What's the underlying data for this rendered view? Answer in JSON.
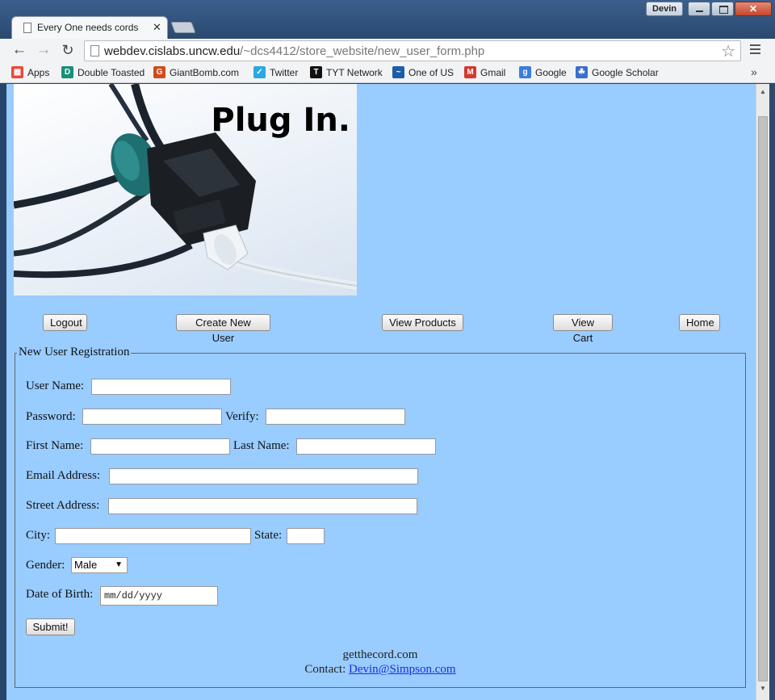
{
  "window": {
    "user_name": "Devin"
  },
  "tab": {
    "title": "Every One needs cords",
    "close_glyph": "✕"
  },
  "toolbar": {
    "url_host": "webdev.cislabs.uncw.edu",
    "url_path": "/~dcs4412/store_website/new_user_form.php"
  },
  "bookmarks": [
    {
      "label": "Apps",
      "icon": "apps-grid-icon",
      "color": "#e64a3b"
    },
    {
      "label": "Double Toasted",
      "icon": "double-toasted-icon",
      "color": "#1a8f7a"
    },
    {
      "label": "GiantBomb.com",
      "icon": "giantbomb-icon",
      "color": "#d24b1c"
    },
    {
      "label": "Twitter",
      "icon": "twitter-bird-icon",
      "color": "#2aa9e0"
    },
    {
      "label": "TYT Network",
      "icon": "tyt-icon",
      "color": "#111111"
    },
    {
      "label": "One of US",
      "icon": "oneofus-icon",
      "color": "#1c5fa8"
    },
    {
      "label": "Gmail",
      "icon": "gmail-icon",
      "color": "#d33a2c"
    },
    {
      "label": "Google",
      "icon": "google-icon",
      "color": "#3b7ddd"
    },
    {
      "label": "Google Scholar",
      "icon": "google-scholar-icon",
      "color": "#3b6fc8"
    }
  ],
  "page": {
    "banner_title": "Plug In.",
    "nav": {
      "logout": "Logout",
      "create_user": "Create New User",
      "view_products": "View Products",
      "view_cart": "View Cart",
      "home": "Home"
    },
    "form": {
      "legend": "New User Registration",
      "username_label": "User Name:",
      "password_label": "Password:",
      "verify_label": "Verify:",
      "firstname_label": "First Name:",
      "lastname_label": "Last Name:",
      "email_label": "Email Address:",
      "street_label": "Street Address:",
      "city_label": "City:",
      "state_label": "State:",
      "gender_label": "Gender:",
      "gender_value": "Male",
      "dob_label": "Date of Birth:",
      "dob_placeholder": "mm/dd/yyyy",
      "submit_label": "Submit!"
    },
    "footer": {
      "site": "getthecord.com",
      "contact_label": "Contact:",
      "contact_email": "Devin@Simpson.com"
    },
    "background_color": "#99ccff"
  }
}
